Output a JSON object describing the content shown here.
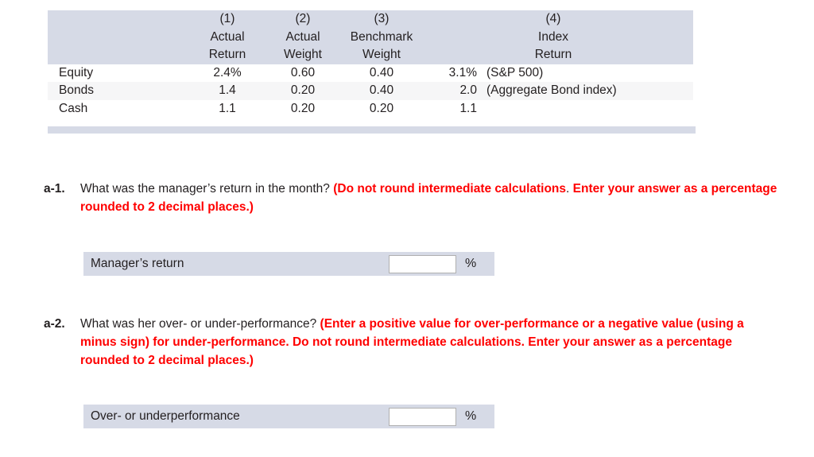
{
  "table": {
    "header": {
      "col_numbers": [
        "(1)",
        "(2)",
        "(3)",
        "(4)"
      ],
      "columns": [
        {
          "num": "(1)",
          "line1": "Actual",
          "line2": "Return"
        },
        {
          "num": "(2)",
          "line1": "Actual",
          "line2": "Weight"
        },
        {
          "num": "(3)",
          "line1": "Benchmark",
          "line2": "Weight"
        },
        {
          "num": "(4)",
          "line1": "Index",
          "line2": "Return"
        }
      ]
    },
    "rows": [
      {
        "label": "Equity",
        "actual_return": "2.4%",
        "actual_weight": "0.60",
        "benchmark_weight": "0.40",
        "index_return": "3.1%",
        "index_name": "(S&P 500)"
      },
      {
        "label": "Bonds",
        "actual_return": "1.4",
        "actual_weight": "0.20",
        "benchmark_weight": "0.40",
        "index_return": "2.0",
        "index_name": "(Aggregate Bond index)"
      },
      {
        "label": "Cash",
        "actual_return": "1.1",
        "actual_weight": "0.20",
        "benchmark_weight": "0.20",
        "index_return": "1.1",
        "index_name": ""
      }
    ]
  },
  "questions": [
    {
      "tag": "a-1.",
      "prompt": "What was the manager’s return in the month? ",
      "instruction_red": "(Do not round intermediate calculations",
      "instruction_tail": ".",
      "instruction_red2": "Enter your answer as a percentage rounded to 2 decimal places.)",
      "answer": {
        "label": "Manager’s return",
        "value": "",
        "placeholder": "",
        "unit": "%"
      }
    },
    {
      "tag": "a-2.",
      "prompt": "What was her over- or under-performance? ",
      "instruction_red": "(Enter a positive value for over-performance or a negative value (using a minus sign) for under-performance. Do not round intermediate calculations. Enter your answer as a percentage rounded to 2 decimal places.)",
      "instruction_tail": "",
      "instruction_red2": "",
      "answer": {
        "label": "Over- or underperformance",
        "value": "",
        "placeholder": "",
        "unit": "%"
      }
    }
  ],
  "colors": {
    "band": "#d6dae6",
    "stripe": "#f6f6f7",
    "red": "#ff0000",
    "text": "#231f20"
  }
}
